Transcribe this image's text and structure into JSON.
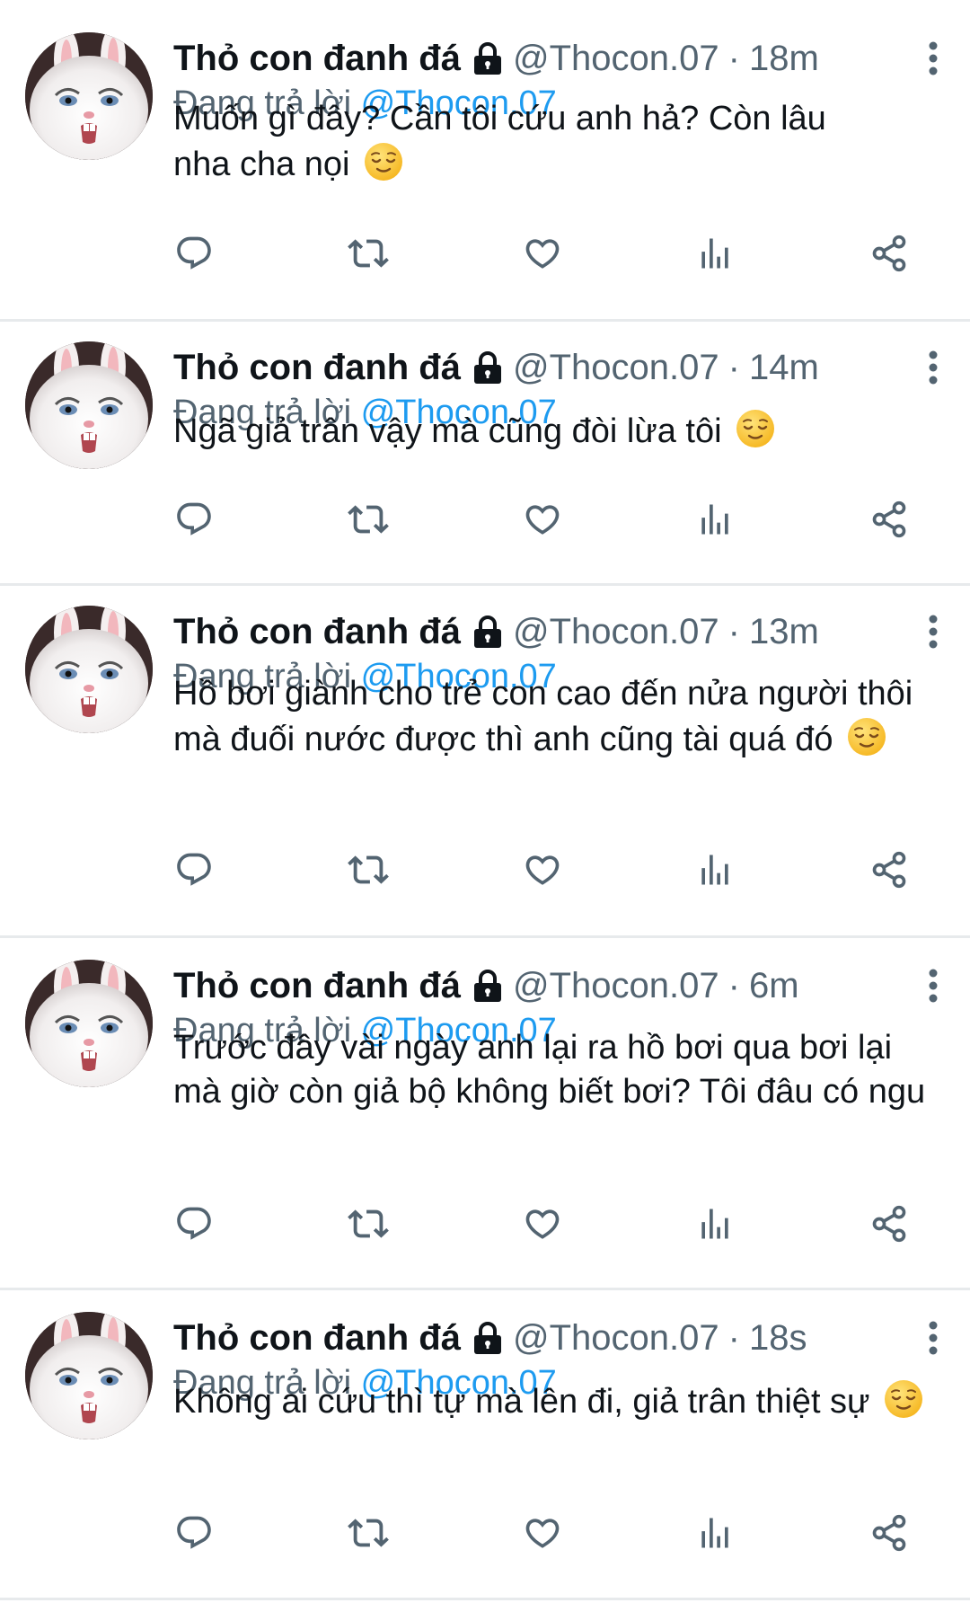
{
  "colors": {
    "name": "#0f1419",
    "secondary": "#536471",
    "link": "#1d9bf0",
    "divider": "#e7eaec"
  },
  "tweets": [
    {
      "display_name": "Thỏ con đanh đá",
      "handle": "@Thocon.07",
      "separator": "·",
      "time": "18m",
      "reply_label": "Đang trả lời",
      "reply_to": "@Thocon.07",
      "text": "Muốn gì đây? Cần tôi cứu anh hả? Còn lâu nha cha nọi",
      "emoji": "relieved-face"
    },
    {
      "display_name": "Thỏ con đanh đá",
      "handle": "@Thocon.07",
      "separator": "·",
      "time": "14m",
      "reply_label": "Đang trả lời",
      "reply_to": "@Thocon.07",
      "text": "Ngã giả trân vậy mà cũng đòi lừa tôi",
      "emoji": "relieved-face"
    },
    {
      "display_name": "Thỏ con đanh đá",
      "handle": "@Thocon.07",
      "separator": "·",
      "time": "13m",
      "reply_label": "Đang trả lời",
      "reply_to": "@Thocon.07",
      "text": "Hồ bơi giành cho trẻ con cao đến nửa người thôi mà đuối nước được thì anh cũng tài quá đó",
      "emoji": "relieved-face"
    },
    {
      "display_name": "Thỏ con đanh đá",
      "handle": "@Thocon.07",
      "separator": "·",
      "time": "6m",
      "reply_label": "Đang trả lời",
      "reply_to": "@Thocon.07",
      "text": "Trước đây vài ngày anh lại ra hồ bơi qua bơi lại mà giờ còn giả bộ không biết bơi? Tôi đâu có ngu",
      "emoji": ""
    },
    {
      "display_name": "Thỏ con đanh đá",
      "handle": "@Thocon.07",
      "separator": "·",
      "time": "18s",
      "reply_label": "Đang trả lời",
      "reply_to": "@Thocon.07",
      "text": "Không ai cứu thì tự mà lên đi, giả trân thiệt sự",
      "emoji": "relieved-face"
    }
  ]
}
